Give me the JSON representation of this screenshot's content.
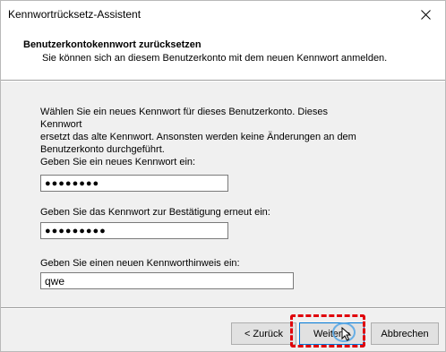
{
  "window": {
    "title": "Kennwortrücksetz-Assistent"
  },
  "header": {
    "title": "Benutzerkontokennwort zurücksetzen",
    "subtitle": "Sie können sich an diesem Benutzerkonto mit dem neuen Kennwort anmelden."
  },
  "content": {
    "intro_line1": "Wählen Sie ein neues Kennwort für dieses Benutzerkonto. Dieses Kennwort",
    "intro_line2": "ersetzt das alte Kennwort. Ansonsten werden keine Änderungen an dem",
    "intro_line3": "Benutzerkonto durchgeführt.",
    "new_password_label": "Geben Sie ein neues Kennwort ein:",
    "new_password_value": "●●●●●●●●",
    "confirm_password_label": "Geben Sie das Kennwort zur Bestätigung erneut ein:",
    "confirm_password_value": "●●●●●●●●●",
    "hint_label": "Geben Sie einen neuen Kennworthinweis ein:",
    "hint_value": "qwe"
  },
  "footer": {
    "back_label": "< Zurück",
    "next_label": "Weiter >",
    "cancel_label": "Abbrechen"
  },
  "colors": {
    "highlight": "#e0000a",
    "default_button_border": "#0078d7"
  }
}
